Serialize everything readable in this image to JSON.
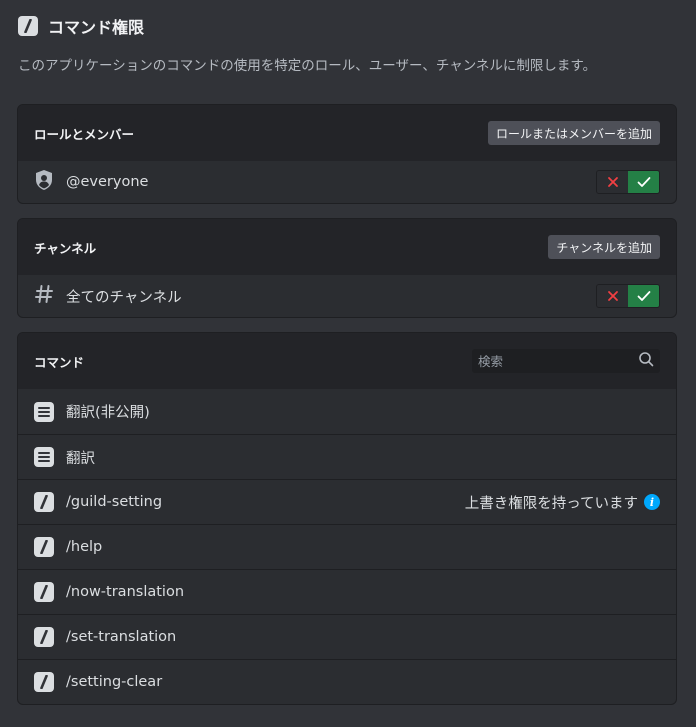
{
  "header": {
    "title": "コマンド権限",
    "subtitle": "このアプリケーションのコマンドの使用を特定のロール、ユーザー、チャンネルに制限します。"
  },
  "roles_section": {
    "title": "ロールとメンバー",
    "add_button": "ロールまたはメンバーを追加",
    "rows": [
      {
        "label": "@everyone",
        "icon": "role-shield-icon",
        "state": "allow"
      }
    ]
  },
  "channels_section": {
    "title": "チャンネル",
    "add_button": "チャンネルを追加",
    "rows": [
      {
        "label": "全てのチャンネル",
        "icon": "hash-icon",
        "state": "allow"
      }
    ]
  },
  "commands_section": {
    "title": "コマンド",
    "search_placeholder": "検索",
    "override_text": "上書き権限を持っています",
    "items": [
      {
        "label": "翻訳(非公開)",
        "icon": "message-command-icon"
      },
      {
        "label": "翻訳",
        "icon": "message-command-icon"
      },
      {
        "label": "/guild-setting",
        "icon": "slash-command-icon"
      },
      {
        "label": "/help",
        "icon": "slash-command-icon"
      },
      {
        "label": "/now-translation",
        "icon": "slash-command-icon"
      },
      {
        "label": "/set-translation",
        "icon": "slash-command-icon"
      },
      {
        "label": "/setting-clear",
        "icon": "slash-command-icon"
      }
    ]
  },
  "colors": {
    "background": "#313338",
    "card": "#2b2d31",
    "card_header": "#232428",
    "allow": "#248046",
    "deny": "#f23f43",
    "info": "#00a8fc"
  }
}
